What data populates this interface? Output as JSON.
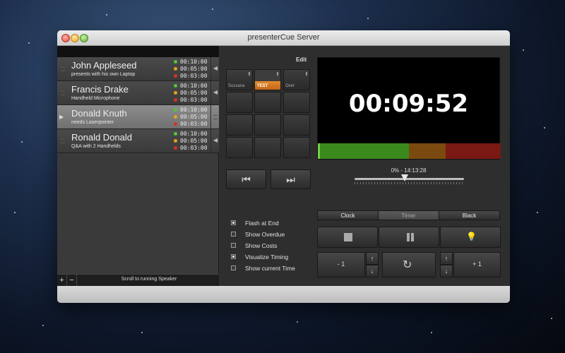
{
  "window": {
    "title": "presenterCue Server"
  },
  "speakers": [
    {
      "name": "John Appleseed",
      "subtitle": "presents with his own Laptop",
      "times": [
        "00:10:00",
        "00:05:00",
        "00:03:00"
      ],
      "active": false
    },
    {
      "name": "Francis Drake",
      "subtitle": "Handheld Microphone",
      "times": [
        "00:10:00",
        "00:05:00",
        "00:03:00"
      ],
      "active": false
    },
    {
      "name": "Donald Knuth",
      "subtitle": "needs Laserpointer",
      "times": [
        "00:10:00",
        "00:05:00",
        "00:03:00"
      ],
      "active": true
    },
    {
      "name": "Ronald Donald",
      "subtitle": "Q&A with 2 Handhelds",
      "times": [
        "00:10:00",
        "00:05:00",
        "00:03:00"
      ],
      "active": false
    }
  ],
  "list_footer": {
    "add": "+",
    "remove": "−",
    "scroll_label": "Scroll to running Speaker"
  },
  "cues": {
    "edit_label": "Edit",
    "labels": [
      "Sussana",
      "TEST",
      "Over"
    ]
  },
  "nav": {
    "prev_icon": "skip-back-icon",
    "next_icon": "skip-forward-icon"
  },
  "preview": {
    "time": "00:09:52",
    "progress_label": "0% - 14:13:28",
    "slider_position": 0.46
  },
  "options": [
    {
      "label": "Flash at End",
      "checked": true
    },
    {
      "label": "Show Overdue",
      "checked": false
    },
    {
      "label": "Show Costs",
      "checked": false
    },
    {
      "label": "Visualize Timing",
      "checked": true
    },
    {
      "label": "Show current Time",
      "checked": false
    }
  ],
  "mode": {
    "options": [
      "Clock",
      "Timer",
      "Black"
    ],
    "selected": "Timer"
  },
  "controls": {
    "stop_icon": "stop-icon",
    "pause_icon": "pause-icon",
    "light_icon": "lightbulb-icon",
    "reset_icon": "reset-icon"
  },
  "steppers": {
    "minus_label": "- 1",
    "plus_label": "+ 1",
    "up": "↑",
    "down": "↓"
  },
  "colors": {
    "green": "#53c633",
    "yellow": "#e2a31d",
    "red": "#d7302c",
    "accent_orange": "#e38a2a"
  }
}
